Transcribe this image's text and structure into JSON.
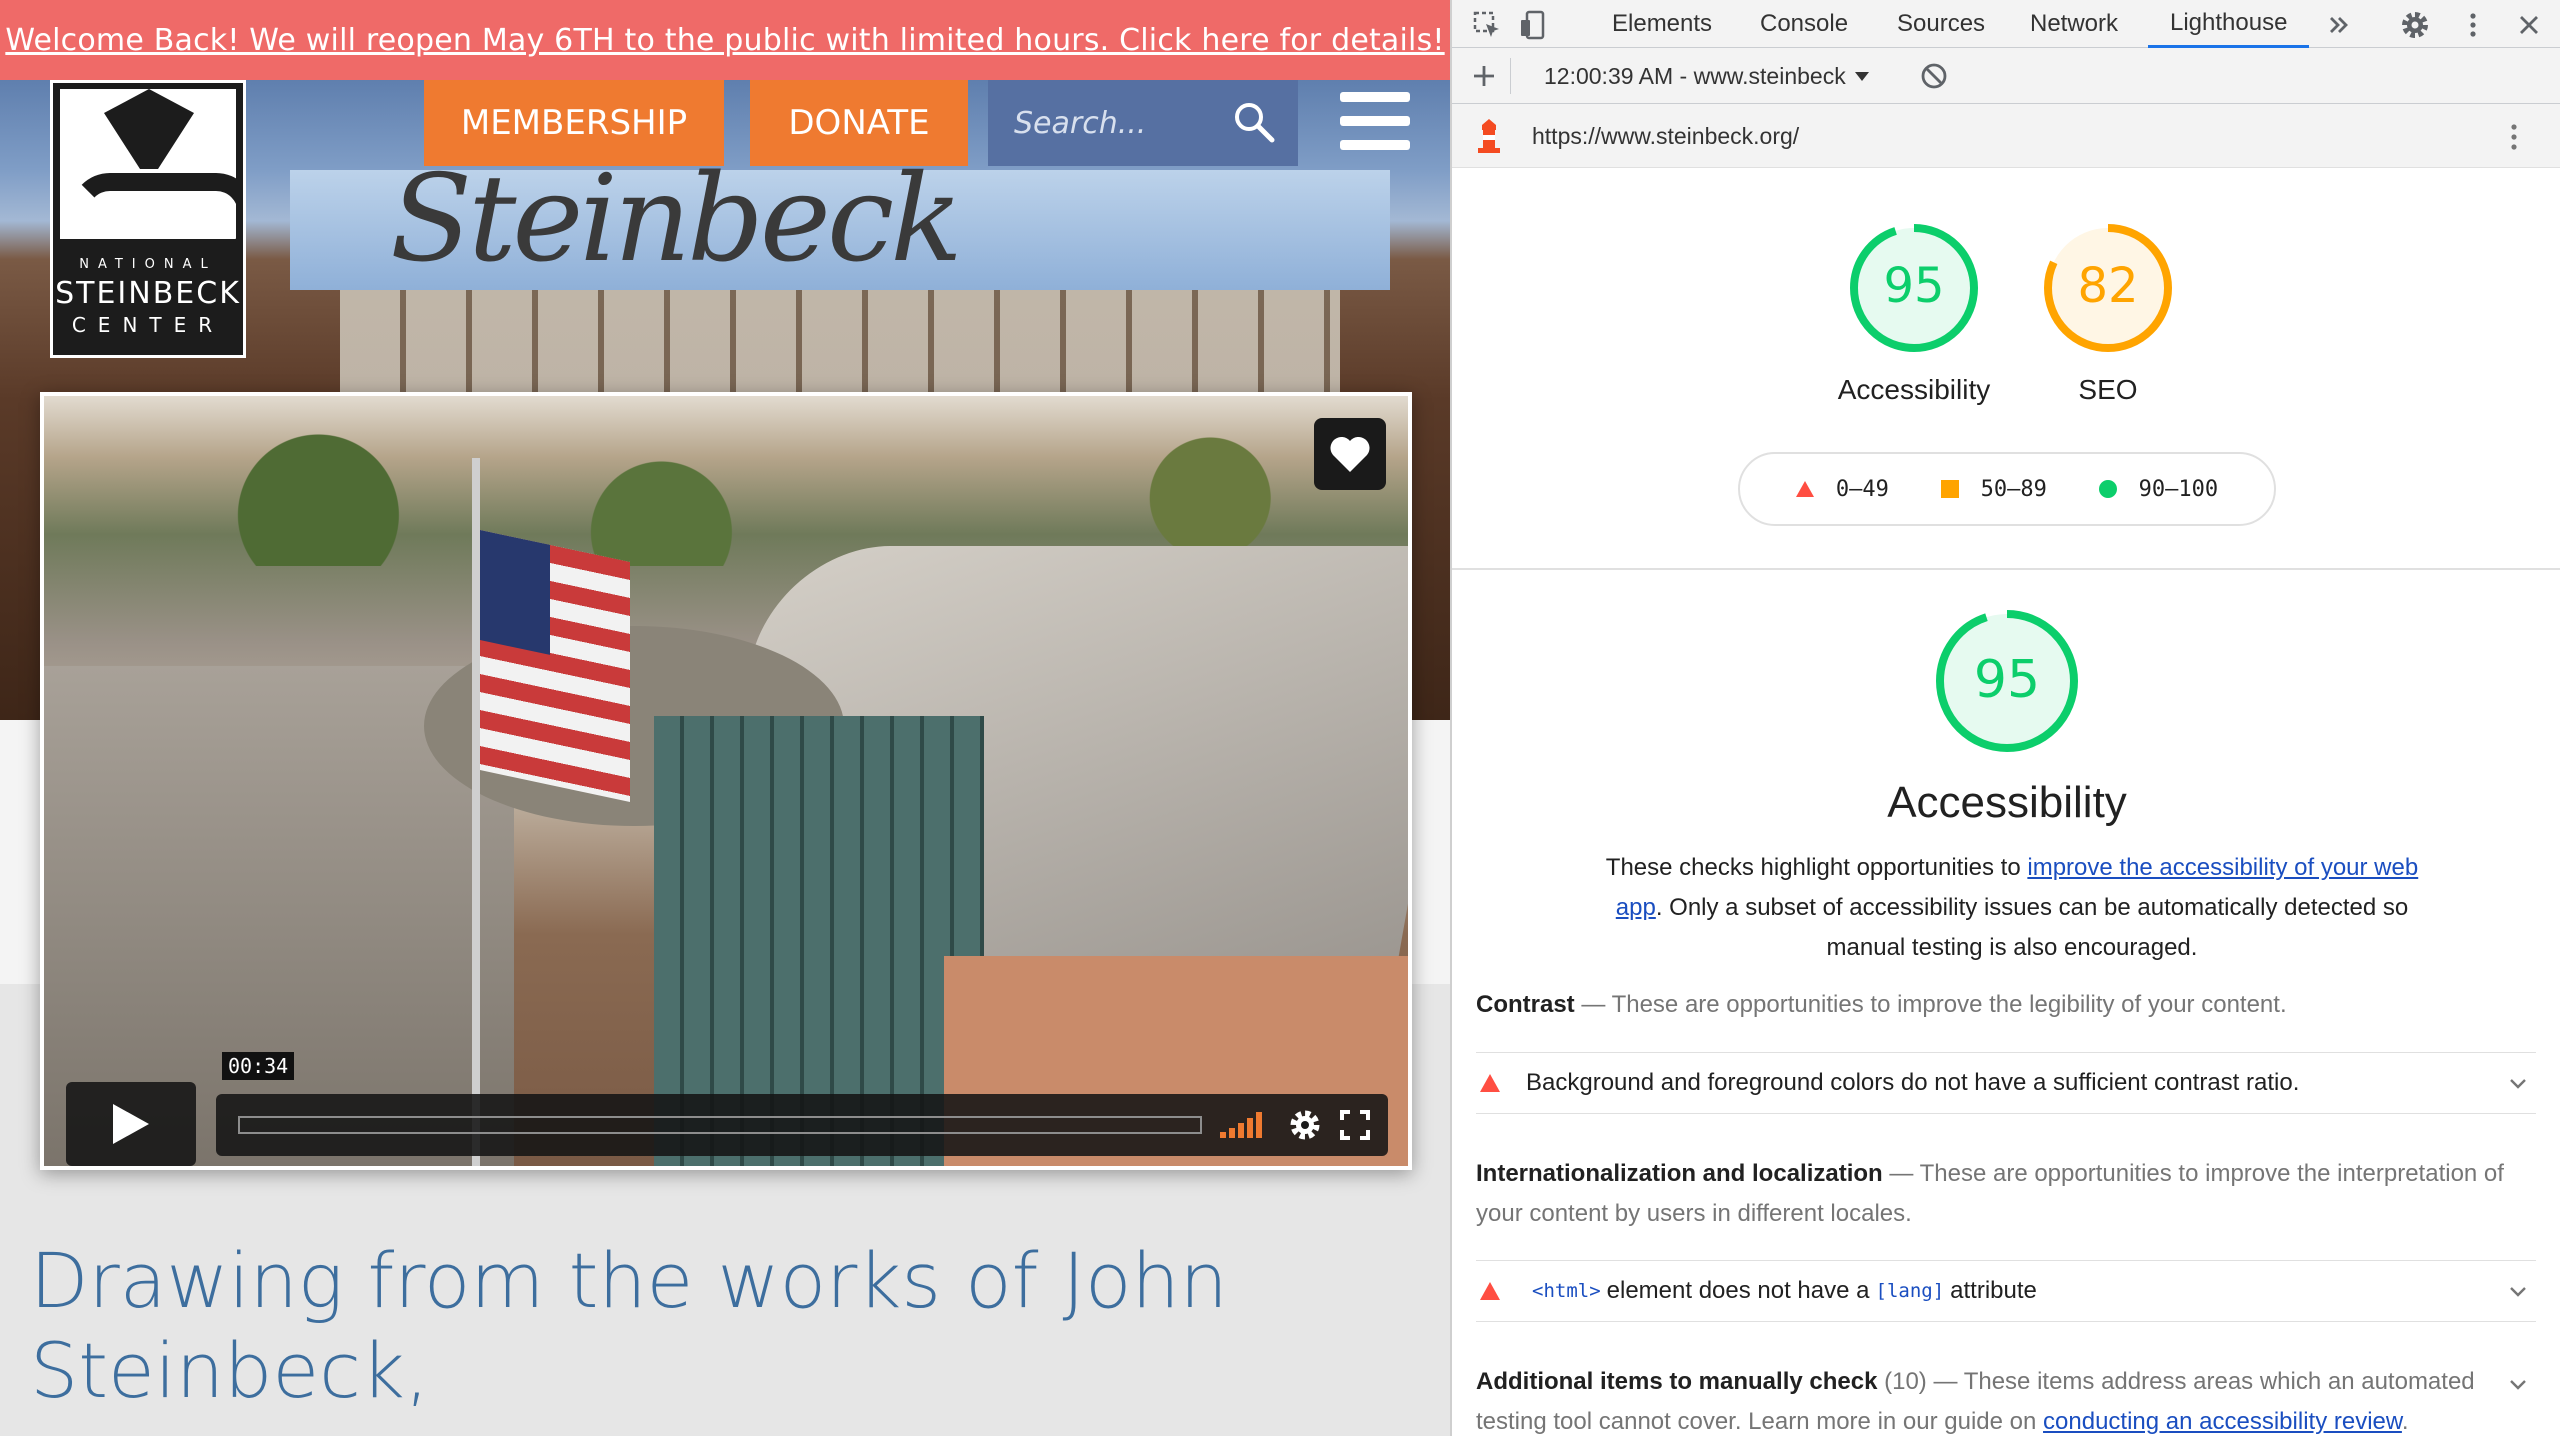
{
  "site": {
    "banner_text": "Welcome Back! We will reopen May 6TH to the public with limited hours. Click here for details!",
    "logo": {
      "line1": "NATIONAL",
      "line2": "STEINBECK",
      "line3": "CENTER"
    },
    "nav": {
      "membership": "MEMBERSHIP",
      "donate": "DONATE"
    },
    "search_placeholder": "Search...",
    "video": {
      "time": "00:34",
      "progress_fraction": 0.0
    },
    "headline": "Drawing from the works of John Steinbeck,"
  },
  "devtools": {
    "tabs": [
      "Elements",
      "Console",
      "Sources",
      "Network",
      "Lighthouse"
    ],
    "active_tab": "Lighthouse",
    "report_selector": "12:00:39 AM - www.steinbeck",
    "url": "https://www.steinbeck.org/",
    "scores": [
      {
        "label": "Accessibility",
        "value": "95",
        "color": "#0cce6b"
      },
      {
        "label": "SEO",
        "value": "82",
        "color": "#ffa400"
      }
    ],
    "legend": {
      "fail": "0–49",
      "average": "50–89",
      "pass": "90–100"
    },
    "category": {
      "score": "95",
      "title": "Accessibility",
      "desc_before": "These checks highlight opportunities to ",
      "desc_link": "improve the accessibility of your web app",
      "desc_after": ". Only a subset of accessibility issues can be automatically detected so manual testing is also encouraged."
    },
    "groups": {
      "contrast_title": "Contrast",
      "contrast_desc": "These are opportunities to improve the legibility of your content.",
      "contrast_audit": "Background and foreground colors do not have a sufficient contrast ratio.",
      "i18n_title": "Internationalization and localization",
      "i18n_desc": "These are opportunities to improve the interpretation of your content by users in different locales.",
      "lang_audit_code1": "<html>",
      "lang_audit_text": "element does not have a",
      "lang_audit_code2": "[lang]",
      "lang_audit_text2": "attribute",
      "manual_title": "Additional items to manually check",
      "manual_count": "(10)",
      "manual_desc": "These items address areas which an automated testing tool cannot cover. Learn more in our guide on ",
      "manual_link": "conducting an accessibility review",
      "manual_end": "."
    }
  }
}
